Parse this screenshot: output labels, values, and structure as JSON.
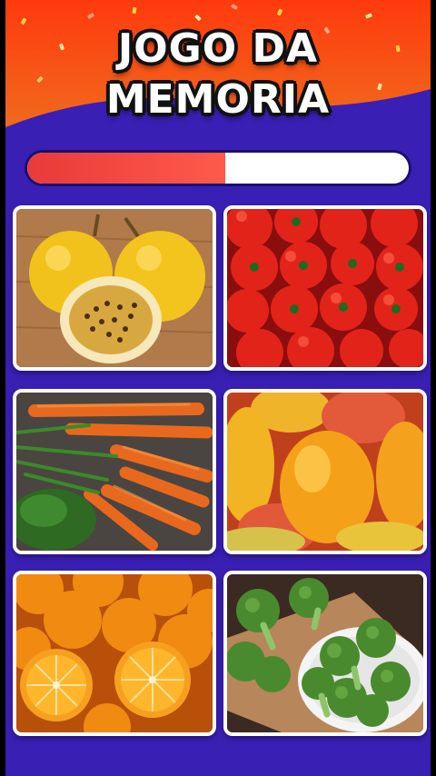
{
  "game": {
    "title_line1": "JOGO DA",
    "title_line2": "MEMORIA",
    "progress_fraction": 0.52
  },
  "colors": {
    "header": "#f04a1a",
    "background": "#3a1fb5",
    "progress_fill": "#e83a3a",
    "progress_track": "#ffffff"
  },
  "cards": [
    {
      "icon": "passion-fruit-icon",
      "subject": "passion-fruit"
    },
    {
      "icon": "tomatoes-icon",
      "subject": "tomatoes"
    },
    {
      "icon": "carrots-icon",
      "subject": "carrots"
    },
    {
      "icon": "mangoes-icon",
      "subject": "mangoes"
    },
    {
      "icon": "oranges-icon",
      "subject": "oranges"
    },
    {
      "icon": "broccoli-icon",
      "subject": "broccoli"
    }
  ]
}
